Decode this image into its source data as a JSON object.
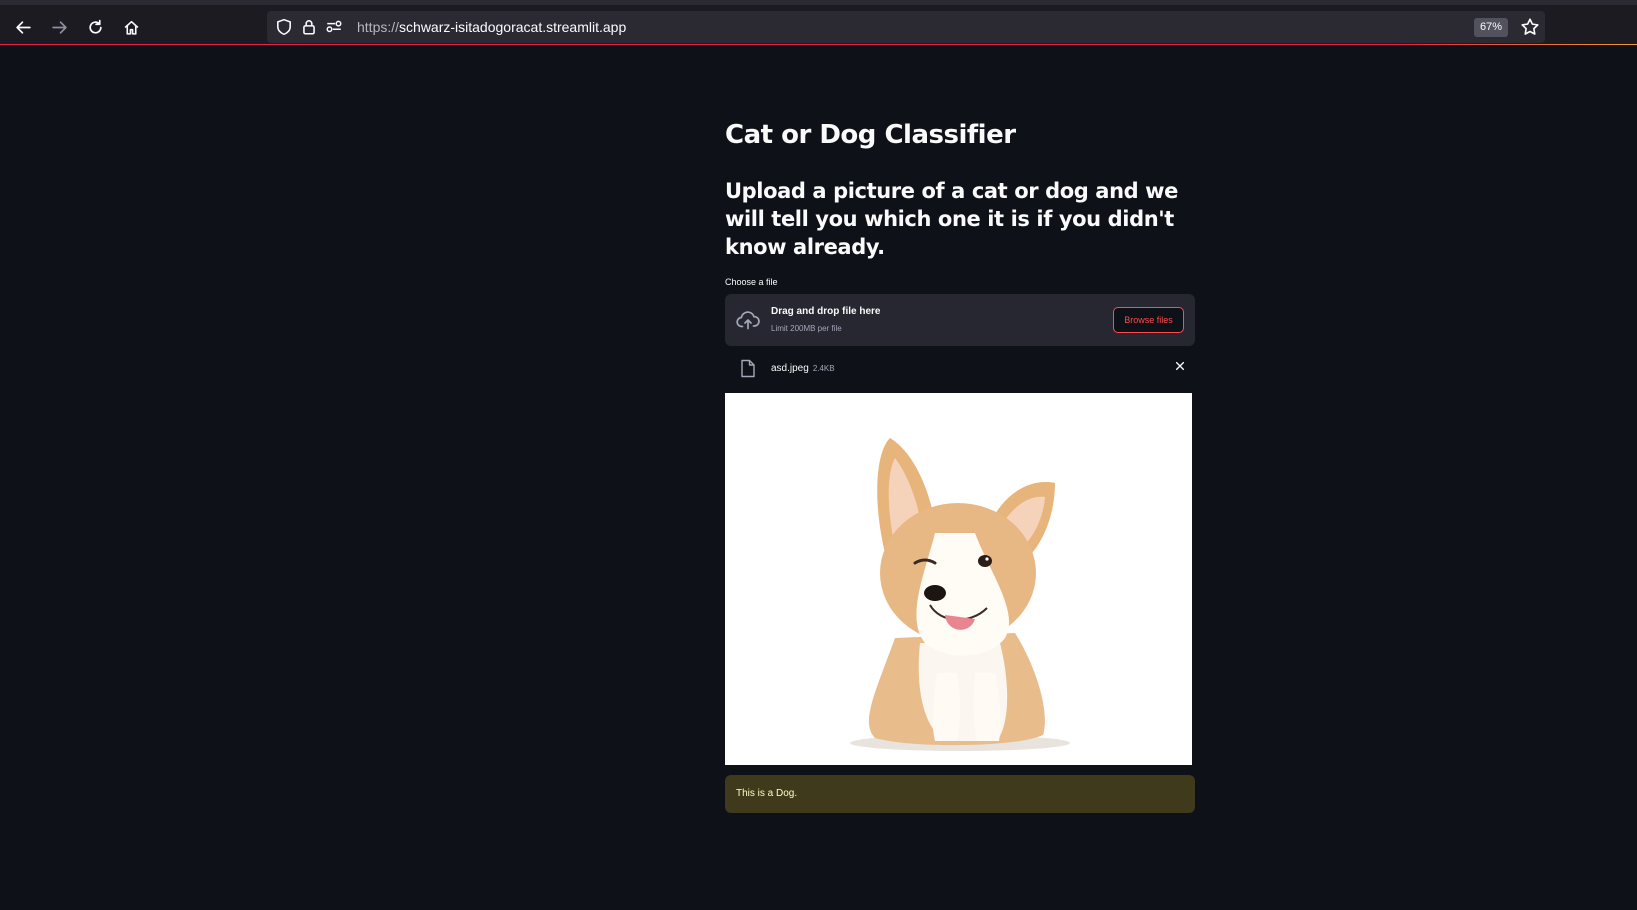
{
  "browser": {
    "url_scheme": "https://",
    "url_host": "schwarz-isitadogoracat.streamlit.app",
    "zoom": "67%",
    "icons": [
      "back-arrow-icon",
      "forward-arrow-icon",
      "reload-icon",
      "home-icon",
      "shield-icon",
      "lock-icon",
      "permissions-icon",
      "star-icon"
    ]
  },
  "app": {
    "title": "Cat or Dog Classifier",
    "subtitle": "Upload a picture of a cat or dog and we will tell you which one it is if you didn't know already.",
    "uploader": {
      "label": "Choose a file",
      "drop_text": "Drag and drop file here",
      "limit_text": "Limit 200MB per file",
      "browse_label": "Browse files"
    },
    "uploaded_file": {
      "name": "asd.jpeg",
      "size": "2.4KB"
    },
    "result_text": "This is a Dog."
  },
  "colors": {
    "background": "#0e1117",
    "accent": "#ff4b4b",
    "warning_bg": "#3e3a1b",
    "warning_text": "#ffffc2"
  }
}
